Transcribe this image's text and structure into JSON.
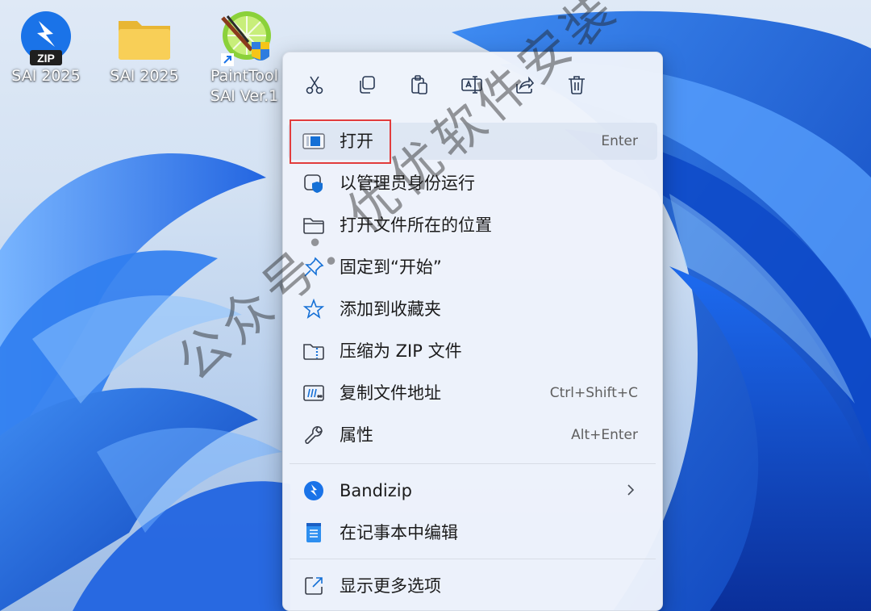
{
  "desktop": {
    "icons": [
      {
        "label": "SAI 2025",
        "badge": "ZIP",
        "icon": "bandizip-zip-archive-icon"
      },
      {
        "label": "SAI 2025",
        "icon": "folder-icon"
      },
      {
        "label_line1": "PaintTool",
        "label_line2": "SAI Ver.1",
        "icon": "painttool-sai-shortcut-icon"
      }
    ]
  },
  "context_menu": {
    "toolbar": [
      {
        "name": "cut",
        "icon": "scissors-icon"
      },
      {
        "name": "copy",
        "icon": "copy-icon"
      },
      {
        "name": "paste",
        "icon": "paste-icon"
      },
      {
        "name": "rename",
        "icon": "rename-icon"
      },
      {
        "name": "share",
        "icon": "share-icon"
      },
      {
        "name": "delete",
        "icon": "trash-icon"
      }
    ],
    "items": [
      {
        "label": "打开",
        "shortcut": "Enter",
        "icon": "app-window-icon"
      },
      {
        "label": "以管理员身份运行",
        "icon": "shield-run-as-admin-icon"
      },
      {
        "label": "打开文件所在的位置",
        "icon": "folder-outline-icon"
      },
      {
        "label": "固定到“开始”",
        "icon": "pin-icon"
      },
      {
        "label": "添加到收藏夹",
        "icon": "star-icon"
      },
      {
        "label": "压缩为 ZIP 文件",
        "icon": "zip-folder-icon"
      },
      {
        "label": "复制文件地址",
        "shortcut": "Ctrl+Shift+C",
        "icon": "copy-path-icon"
      },
      {
        "label": "属性",
        "shortcut": "Alt+Enter",
        "icon": "wrench-icon"
      }
    ],
    "extra_items": [
      {
        "label": "Bandizip",
        "icon": "bandizip-icon",
        "has_submenu": true
      },
      {
        "label": "在记事本中编辑",
        "icon": "notepad-icon"
      }
    ],
    "more": {
      "label": "显示更多选项",
      "icon": "show-more-icon"
    }
  },
  "watermark": {
    "text": "公众号：优优软件安装"
  },
  "colors": {
    "accent": "#1570d6",
    "highlight_box": "#e23c3c",
    "menu_bg": "#eef3fb"
  }
}
